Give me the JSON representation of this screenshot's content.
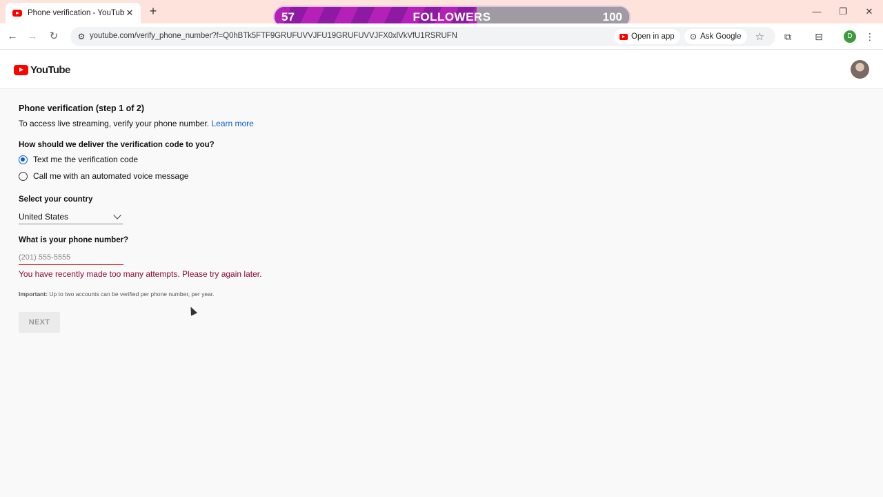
{
  "browser": {
    "tab_title": "Phone verification - YouTube",
    "tab_close": "✕",
    "new_tab": "+",
    "url": "youtube.com/verify_phone_number?f=Q0hBTk5FTF9GRUFUVVJFU19GRUFUVVJFX0xlVkVfU1RSRUFN",
    "open_in_app": "Open in app",
    "ask_google": "Ask Google",
    "profile_initial": "D",
    "window_controls": {
      "minimize": "—",
      "restore": "❐",
      "close": "✕"
    }
  },
  "followers_overlay": {
    "current": "57",
    "label": "FOLLOWERS",
    "goal": "100",
    "progress_fraction": 0.57
  },
  "youtube": {
    "logo_text": "YouTube"
  },
  "form": {
    "title": "Phone verification (step 1 of 2)",
    "subtitle": "To access live streaming, verify your phone number.",
    "learn_more": "Learn more",
    "delivery_question": "How should we deliver the verification code to you?",
    "options": [
      {
        "label": "Text me the verification code",
        "selected": true
      },
      {
        "label": "Call me with an automated voice message",
        "selected": false
      }
    ],
    "country_label": "Select your country",
    "country_value": "United States",
    "phone_label": "What is your phone number?",
    "phone_placeholder": "(201) 555-5555",
    "error": "You have recently made too many attempts. Please try again later.",
    "important_label": "Important:",
    "important_text": "Up to two accounts can be verified per phone number, per year.",
    "next_button": "NEXT"
  },
  "colors": {
    "accent": "#065fd4",
    "error": "#8b0a33",
    "brand_red": "#ff0000"
  }
}
